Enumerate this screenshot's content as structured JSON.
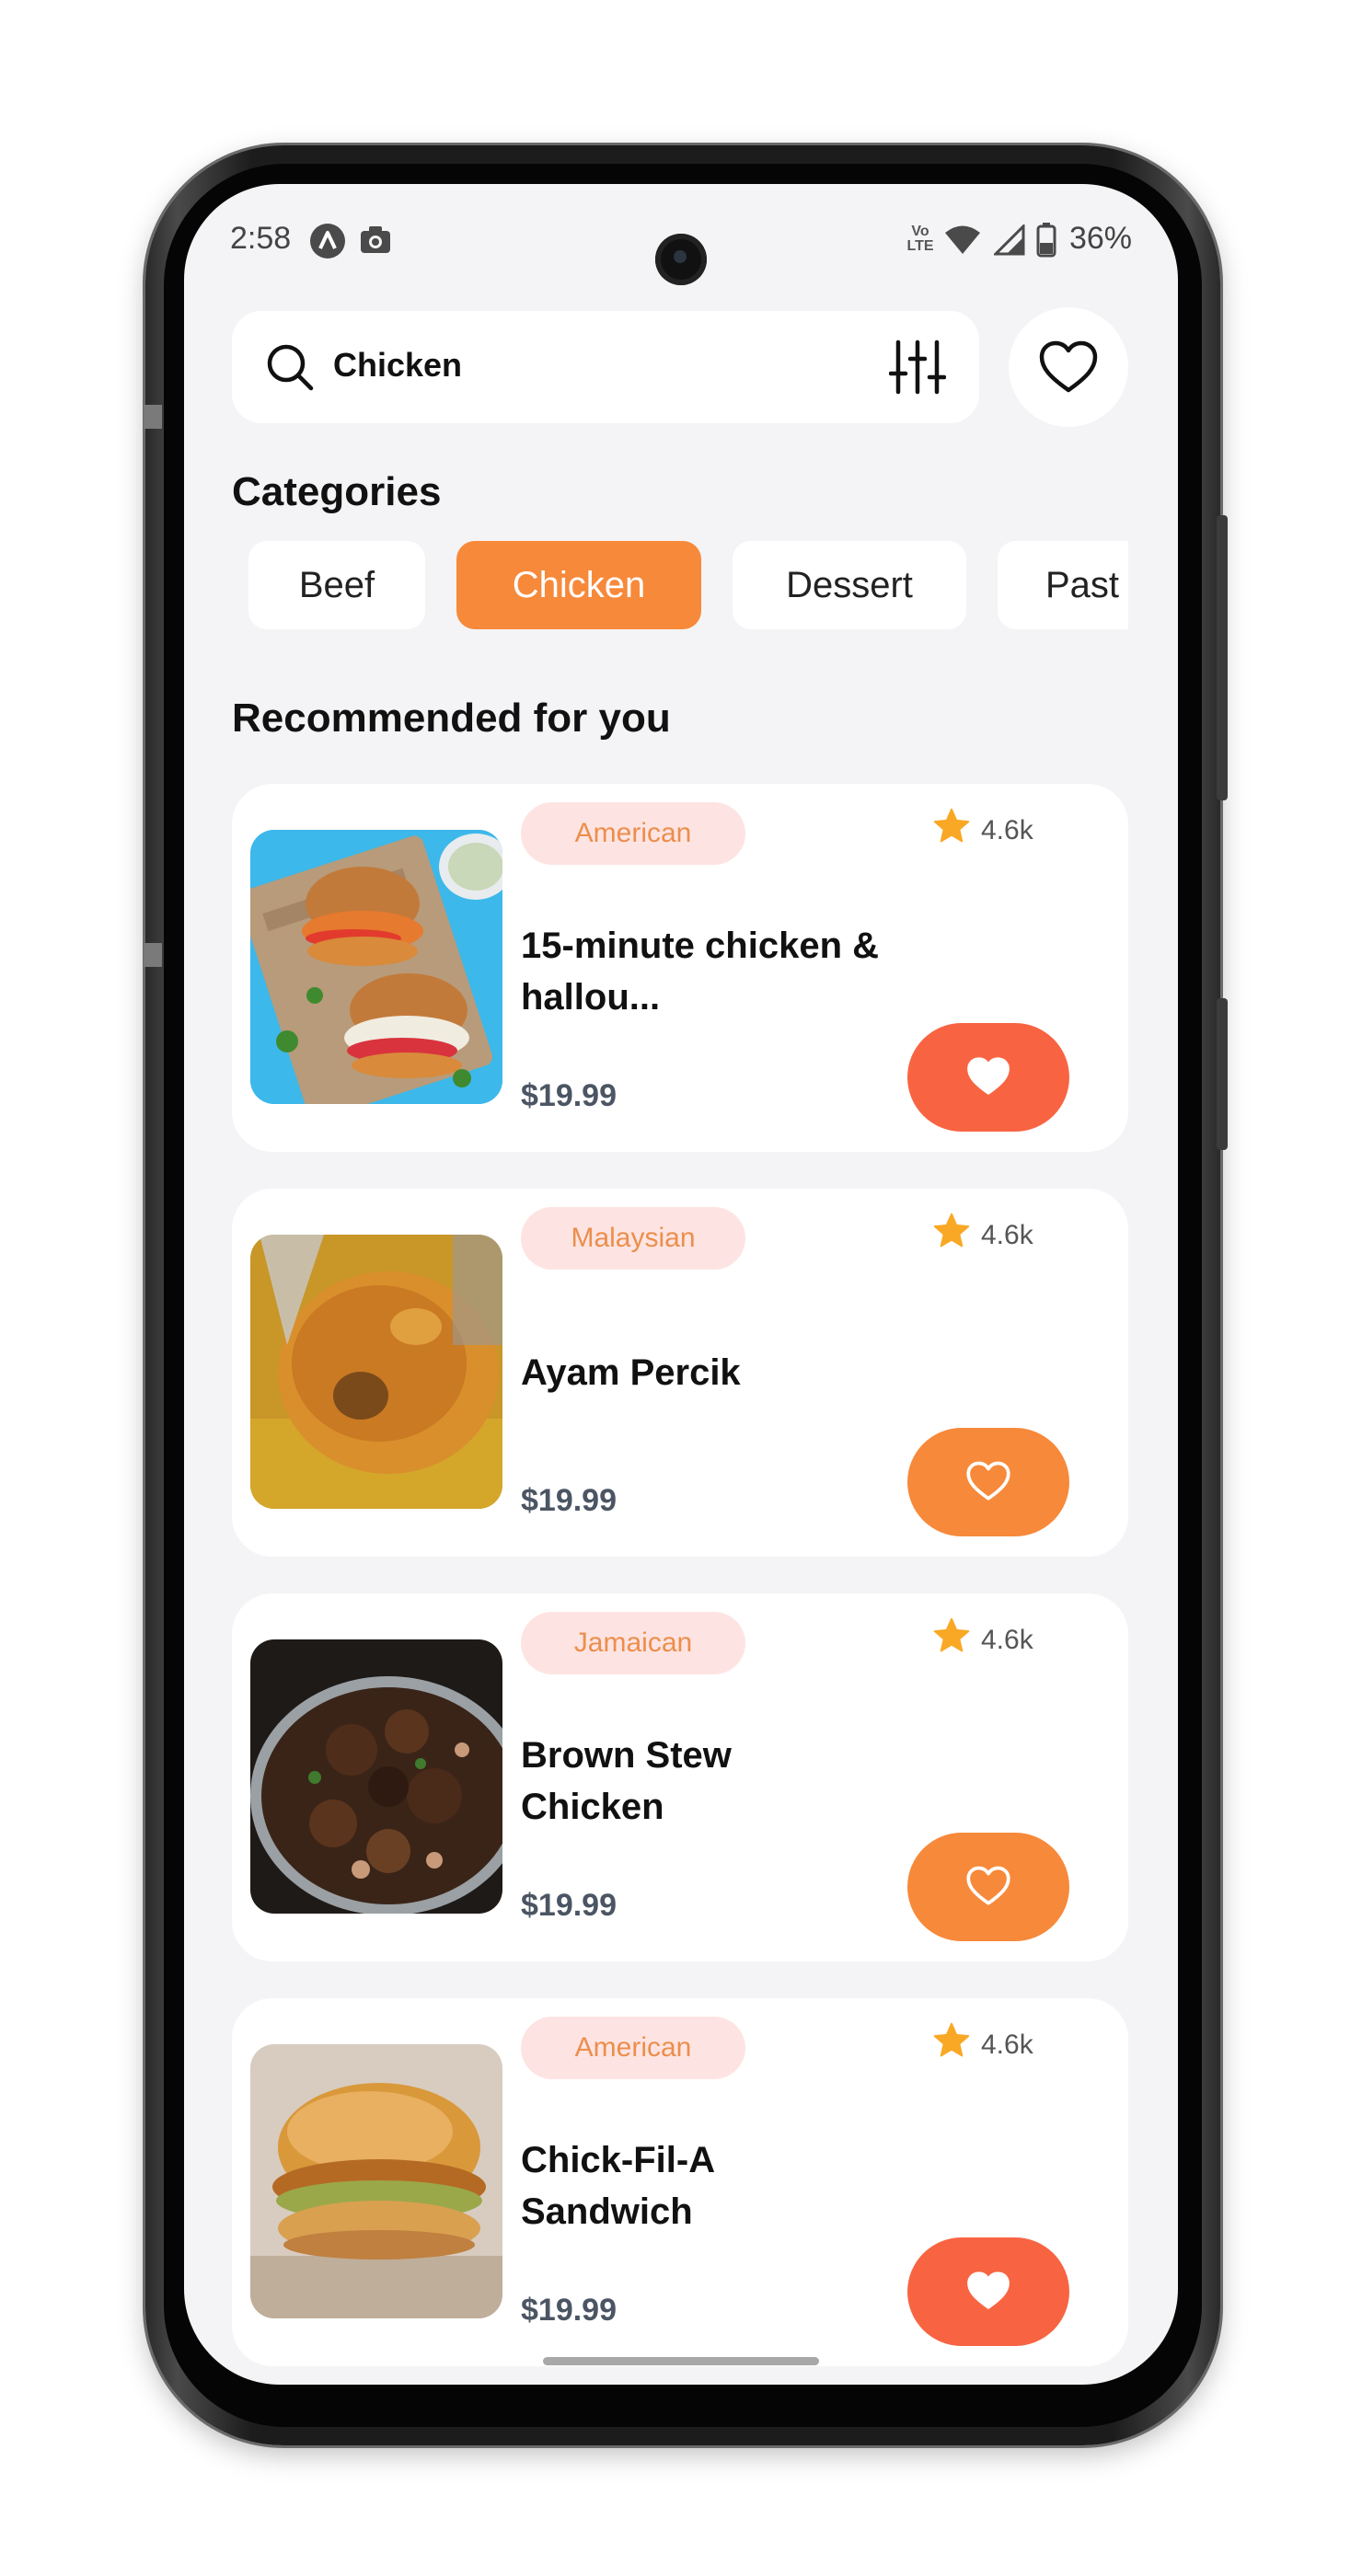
{
  "status_bar": {
    "time": "2:58",
    "battery": "36%",
    "icons": [
      "app-a-icon",
      "camera-icon",
      "volte-icon",
      "wifi-icon",
      "signal-icon",
      "battery-icon"
    ],
    "volte_text": "Vo LTE"
  },
  "search": {
    "value": "Chicken",
    "icon": "search-icon",
    "filter_icon": "sliders-icon"
  },
  "favorites_button_icon": "heart-outline-icon",
  "categories": {
    "title": "Categories",
    "items": [
      {
        "label": "Beef",
        "active": false
      },
      {
        "label": "Chicken",
        "active": true
      },
      {
        "label": "Dessert",
        "active": false
      },
      {
        "label": "Past",
        "active": false
      }
    ]
  },
  "recommended": {
    "title": "Recommended for you",
    "items": [
      {
        "cuisine": "American",
        "rating": "4.6k",
        "name": "15-minute chicken & hallou...",
        "price": "$19.99",
        "favorited": true
      },
      {
        "cuisine": "Malaysian",
        "rating": "4.6k",
        "name": "Ayam Percik",
        "price": "$19.99",
        "favorited": false
      },
      {
        "cuisine": "Jamaican",
        "rating": "4.6k",
        "name": "Brown Stew Chicken",
        "price": "$19.99",
        "favorited": false
      },
      {
        "cuisine": "American",
        "rating": "4.6k",
        "name": "Chick-Fil-A Sandwich",
        "price": "$19.99",
        "favorited": true
      }
    ]
  },
  "colors": {
    "accent": "#f7893a",
    "favorite_active": "#f86442",
    "tag_bg": "#fde4e2",
    "tag_text": "#ec8e4c",
    "star": "#f9a825",
    "screen_bg": "#f4f4f6"
  }
}
